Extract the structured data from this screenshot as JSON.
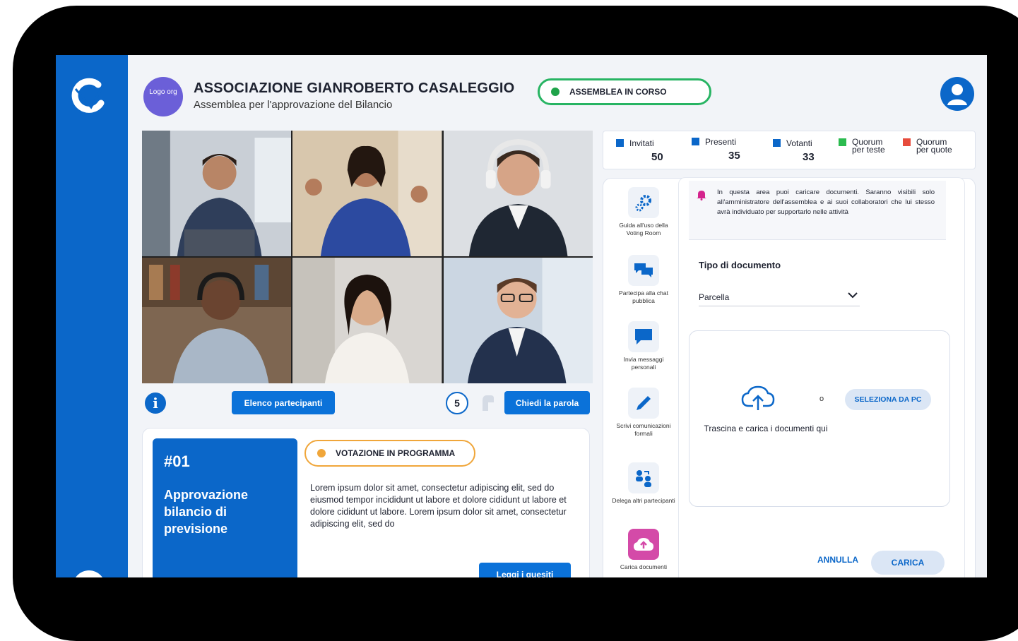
{
  "header": {
    "org_logo_text": "Logo org",
    "org_name": "ASSOCIAZIONE GIANROBERTO CASALEGGIO",
    "subtitle": "Assemblea per l'approvazione del Bilancio",
    "status_label": "ASSEMBLEA IN CORSO"
  },
  "colors": {
    "brand_blue": "#0b67c9",
    "status_green": "#1fa34a",
    "status_orange": "#f0a63a",
    "quorum_teste": "#2bbb4f",
    "quorum_quote": "#e74c3c"
  },
  "video": {
    "participants_button": "Elenco partecipanti",
    "queue_count": "5",
    "ask_to_speak_button": "Chiedi la parola"
  },
  "vote": {
    "number": "#01",
    "title": "Approvazione bilancio di previsione",
    "status_label": "VOTAZIONE IN PROGRAMMA",
    "description": "Lorem ipsum dolor sit amet, consectetur adipiscing elit, sed do eiusmod tempor incididunt ut labore et dolore cididunt ut labore et dolore cididunt ut labore. Lorem ipsum dolor sit amet, consectetur adipiscing elit, sed do",
    "questions_button": "Leggi i quesiti"
  },
  "stats": {
    "invitati": {
      "label": "Invitati",
      "value": "50"
    },
    "presenti": {
      "label": "Presenti",
      "value": "35"
    },
    "votanti": {
      "label": "Votanti",
      "value": "33"
    },
    "quorum_teste": {
      "label_1": "Quorum",
      "label_2": "per teste"
    },
    "quorum_quote": {
      "label_1": "Quorum",
      "label_2": "per quote"
    }
  },
  "tools": [
    {
      "label": "Guida all'uso della Voting Room",
      "icon": "gears-icon"
    },
    {
      "label": "Partecipa alla chat pubblica",
      "icon": "chat-bubbles-icon"
    },
    {
      "label": "Invia messaggi personali",
      "icon": "message-icon"
    },
    {
      "label": "Scrivi comunicazioni formali",
      "icon": "pen-icon"
    },
    {
      "label": "Delega altri partecipanti",
      "icon": "delegate-icon"
    },
    {
      "label": "Carica documenti",
      "icon": "cloud-upload-icon"
    }
  ],
  "upload": {
    "alert_text": "In questa area puoi caricare documenti. Saranno visibili solo all'amministratore dell'assemblea e ai suoi collaboratori che lui stesso avrà individuato per supportarlo nelle attività",
    "doc_type_label": "Tipo di documento",
    "doc_type_value": "Parcella",
    "drop_text": "Trascina e carica i documenti qui",
    "or_text": "o",
    "select_pc_button": "SELEZIONA DA PC",
    "cancel_button": "ANNULLA",
    "upload_button": "CARICA"
  }
}
